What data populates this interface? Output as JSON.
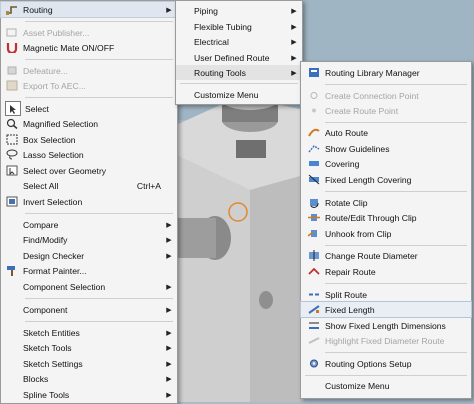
{
  "main_menu": {
    "items": [
      {
        "label": "Routing",
        "arrow": "▶",
        "icon": "routing-icon",
        "state": "highlighted"
      },
      {
        "label": "Asset Publisher...",
        "icon": "asset-publisher-icon",
        "state": "disabled"
      },
      {
        "label": "Magnetic Mate ON/OFF",
        "icon": "magnetic-mate-icon",
        "state": "normal"
      },
      {
        "label": "Defeature...",
        "icon": "defeature-icon",
        "state": "disabled"
      },
      {
        "label": "Export To AEC...",
        "icon": "export-aec-icon",
        "state": "disabled"
      },
      {
        "label": "Select",
        "icon": "select-arrow-icon",
        "state": "normal"
      },
      {
        "label": "Magnified Selection",
        "icon": "magnified-selection-icon",
        "state": "normal"
      },
      {
        "label": "Box Selection",
        "icon": "box-selection-icon",
        "state": "normal"
      },
      {
        "label": "Lasso Selection",
        "icon": "lasso-selection-icon",
        "state": "normal"
      },
      {
        "label": "Select over Geometry",
        "icon": "select-over-geometry-icon",
        "state": "normal"
      },
      {
        "label": "Select All",
        "shortcut": "Ctrl+A",
        "icon": "",
        "state": "normal"
      },
      {
        "label": "Invert Selection",
        "icon": "invert-selection-icon",
        "state": "normal"
      },
      {
        "label": "Compare",
        "arrow": "▶",
        "icon": "",
        "state": "normal"
      },
      {
        "label": "Find/Modify",
        "arrow": "▶",
        "icon": "",
        "state": "normal"
      },
      {
        "label": "Design Checker",
        "arrow": "▶",
        "icon": "",
        "state": "normal"
      },
      {
        "label": "Format Painter...",
        "icon": "format-painter-icon",
        "state": "normal"
      },
      {
        "label": "Component Selection",
        "arrow": "▶",
        "icon": "",
        "state": "normal"
      },
      {
        "label": "Component",
        "arrow": "▶",
        "icon": "",
        "state": "normal"
      },
      {
        "label": "Sketch Entities",
        "arrow": "▶",
        "icon": "",
        "state": "normal"
      },
      {
        "label": "Sketch Tools",
        "arrow": "▶",
        "icon": "",
        "state": "normal"
      },
      {
        "label": "Sketch Settings",
        "arrow": "▶",
        "icon": "",
        "state": "normal"
      },
      {
        "label": "Blocks",
        "arrow": "▶",
        "icon": "",
        "state": "normal"
      },
      {
        "label": "Spline Tools",
        "arrow": "▶",
        "icon": "",
        "state": "normal"
      }
    ]
  },
  "routing_menu": {
    "items": [
      {
        "label": "Piping",
        "arrow": "▶",
        "state": "normal"
      },
      {
        "label": "Flexible Tubing",
        "arrow": "▶",
        "state": "normal"
      },
      {
        "label": "Electrical",
        "arrow": "▶",
        "state": "normal"
      },
      {
        "label": "User Defined Route",
        "arrow": "▶",
        "state": "normal"
      },
      {
        "label": "Routing Tools",
        "arrow": "▶",
        "state": "highlighted"
      },
      {
        "label": "Customize Menu",
        "state": "normal"
      }
    ]
  },
  "routing_tools_menu": {
    "items": [
      {
        "label": "Routing Library Manager",
        "icon": "library-manager-icon",
        "state": "normal"
      },
      {
        "label": "Create Connection Point",
        "icon": "connection-point-icon",
        "state": "disabled"
      },
      {
        "label": "Create Route Point",
        "icon": "route-point-icon",
        "state": "disabled"
      },
      {
        "label": "Auto Route",
        "icon": "auto-route-icon",
        "state": "normal"
      },
      {
        "label": "Show Guidelines",
        "icon": "guidelines-icon",
        "state": "normal"
      },
      {
        "label": "Covering",
        "icon": "covering-icon",
        "state": "normal"
      },
      {
        "label": "Fixed Length Covering",
        "icon": "fixed-length-covering-icon",
        "state": "normal"
      },
      {
        "label": "Rotate Clip",
        "icon": "rotate-clip-icon",
        "state": "normal"
      },
      {
        "label": "Route/Edit Through Clip",
        "icon": "route-through-clip-icon",
        "state": "normal"
      },
      {
        "label": "Unhook from Clip",
        "icon": "unhook-clip-icon",
        "state": "normal"
      },
      {
        "label": "Change Route Diameter",
        "icon": "route-diameter-icon",
        "state": "normal"
      },
      {
        "label": "Repair Route",
        "icon": "repair-route-icon",
        "state": "normal"
      },
      {
        "label": "Split Route",
        "icon": "split-route-icon",
        "state": "normal"
      },
      {
        "label": "Fixed Length",
        "icon": "fixed-length-icon",
        "state": "selected"
      },
      {
        "label": "Show Fixed Length Dimensions",
        "icon": "fixed-length-dims-icon",
        "state": "normal"
      },
      {
        "label": "Highlight Fixed Diameter Route",
        "icon": "fixed-diameter-icon",
        "state": "disabled"
      },
      {
        "label": "Routing Options Setup",
        "icon": "options-setup-icon",
        "state": "normal"
      },
      {
        "label": "Customize Menu",
        "icon": "",
        "state": "normal"
      }
    ]
  },
  "colors": {
    "menu_bg": "#f4f4f4",
    "highlight": "#dfe6ef",
    "disabled_text": "#a4a4a4",
    "background": "#a8bcc8"
  }
}
